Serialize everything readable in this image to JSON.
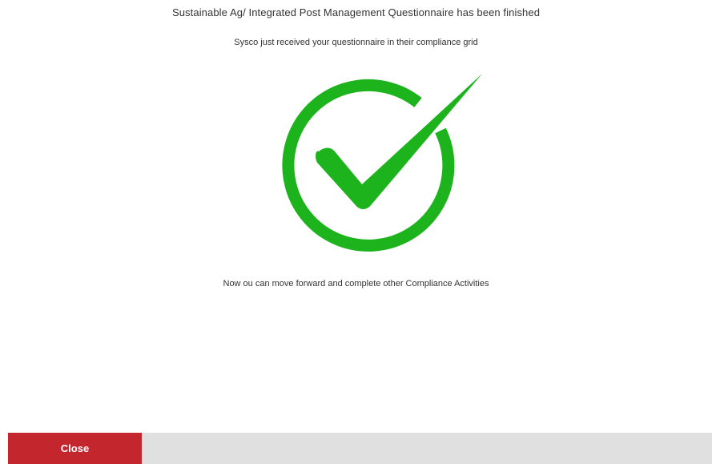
{
  "dialog": {
    "title": "Sustainable Ag/ Integrated Post Management Questionnaire has been finished",
    "subtitle": "Sysco just received your questionnaire in their compliance grid",
    "message": "Now ou can move forward and complete other Compliance Activities",
    "icon": "check-circle-icon",
    "icon_color": "#1db31d"
  },
  "footer": {
    "close_label": "Close",
    "close_color": "#c4262e",
    "bar_color": "#e0e0e0"
  }
}
